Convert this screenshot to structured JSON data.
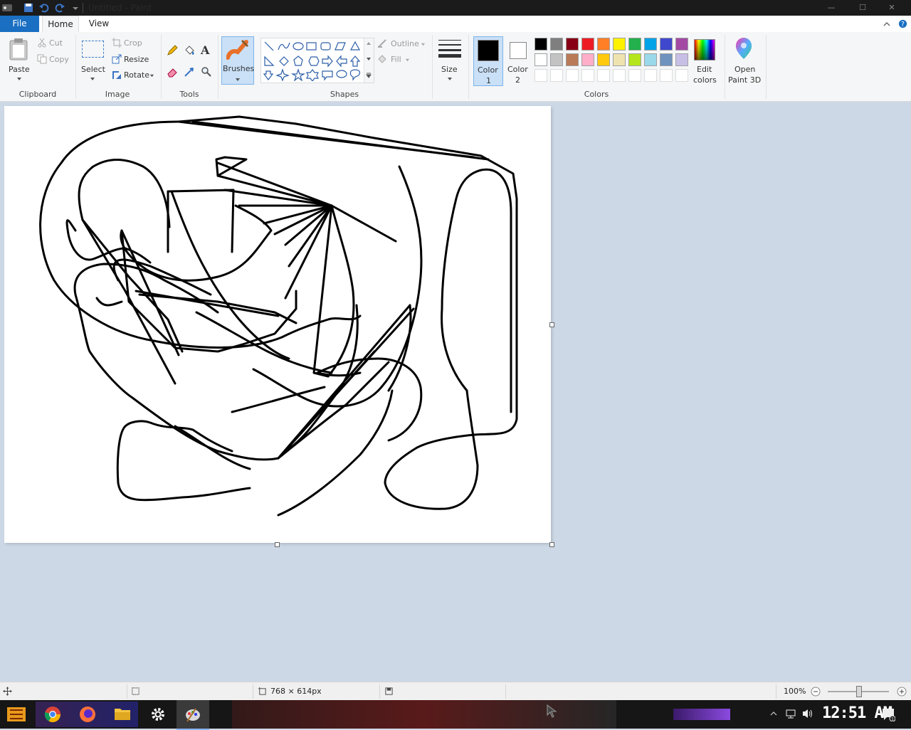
{
  "window": {
    "title": "Untitled - Paint",
    "controls": {
      "minimize": "—",
      "maximize": "☐",
      "close": "✕"
    }
  },
  "tabs": {
    "file": "File",
    "home": "Home",
    "view": "View"
  },
  "ribbon": {
    "clipboard": {
      "paste": "Paste",
      "cut": "Cut",
      "copy": "Copy",
      "group": "Clipboard"
    },
    "image": {
      "select": "Select",
      "crop": "Crop",
      "resize": "Resize",
      "rotate": "Rotate",
      "group": "Image"
    },
    "tools": {
      "group": "Tools",
      "text_glyph": "A"
    },
    "brushes": {
      "label": "Brushes"
    },
    "shapes": {
      "outline": "Outline",
      "fill": "Fill",
      "group": "Shapes"
    },
    "size": {
      "label": "Size"
    },
    "color1": {
      "label1": "Color",
      "label2": "1",
      "value": "#000000"
    },
    "color2": {
      "label1": "Color",
      "label2": "2",
      "value": "#ffffff"
    },
    "colors_group": "Colors",
    "edit_colors": {
      "label1": "Edit",
      "label2": "colors"
    },
    "paint3d": {
      "label1": "Open",
      "label2": "Paint 3D"
    },
    "palette_row1": [
      "#000000",
      "#7f7f7f",
      "#880015",
      "#ed1c24",
      "#ff7f27",
      "#fff200",
      "#22b14c",
      "#00a2e8",
      "#3f48cc",
      "#a349a4"
    ],
    "palette_row2": [
      "#ffffff",
      "#c3c3c3",
      "#b97a57",
      "#ffaec9",
      "#ffc90e",
      "#efe4b0",
      "#b5e61d",
      "#99d9ea",
      "#7092be",
      "#c8bfe7"
    ]
  },
  "status": {
    "dimensions": "768 × 614px",
    "zoom": "100%"
  },
  "taskbar": {
    "clock": "12:51 AM"
  }
}
